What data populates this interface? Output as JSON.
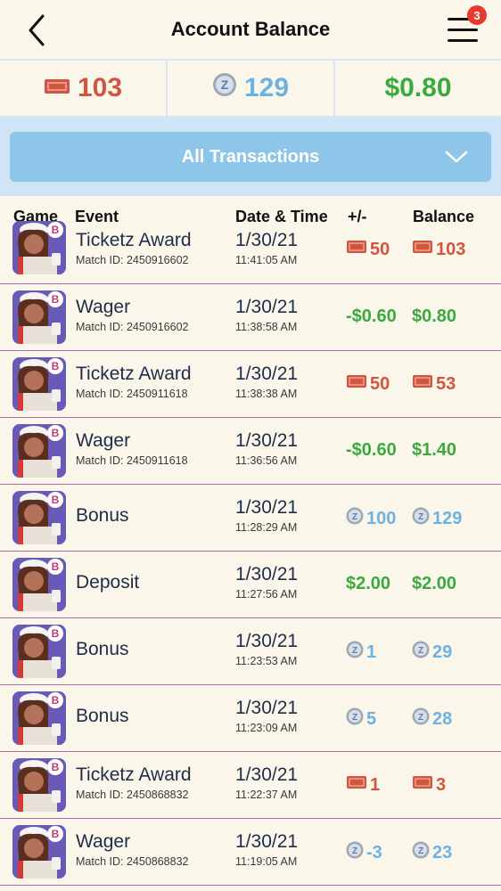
{
  "header": {
    "title": "Account Balance",
    "notification_count": "3"
  },
  "balances": {
    "tickets": "103",
    "coins": "129",
    "cash": "$0.80"
  },
  "filter": {
    "label": "All Transactions"
  },
  "columns": {
    "game": "Game",
    "event": "Event",
    "datetime": "Date & Time",
    "change": "+/-",
    "balance": "Balance"
  },
  "colors": {
    "ticket_red": "#d2553f",
    "coin_blue": "#6db2e0",
    "cash_green": "#3aaa3f",
    "filter_blue": "#8ec6ea",
    "row_divider": "#b06aa8"
  },
  "transactions": [
    {
      "event": "Ticketz Award",
      "match": "Match ID: 2450916602",
      "date": "1/30/21",
      "time": "11:41:05 AM",
      "change": "50",
      "change_type": "ticket",
      "balance": "103",
      "balance_type": "ticket"
    },
    {
      "event": "Wager",
      "match": "Match ID: 2450916602",
      "date": "1/30/21",
      "time": "11:38:58 AM",
      "change": "-$0.60",
      "change_type": "cash",
      "balance": "$0.80",
      "balance_type": "cash"
    },
    {
      "event": "Ticketz Award",
      "match": "Match ID: 2450911618",
      "date": "1/30/21",
      "time": "11:38:38 AM",
      "change": "50",
      "change_type": "ticket",
      "balance": "53",
      "balance_type": "ticket"
    },
    {
      "event": "Wager",
      "match": "Match ID: 2450911618",
      "date": "1/30/21",
      "time": "11:36:56 AM",
      "change": "-$0.60",
      "change_type": "cash",
      "balance": "$1.40",
      "balance_type": "cash"
    },
    {
      "event": "Bonus",
      "match": "",
      "date": "1/30/21",
      "time": "11:28:29 AM",
      "change": "100",
      "change_type": "coin",
      "balance": "129",
      "balance_type": "coin"
    },
    {
      "event": "Deposit",
      "match": "",
      "date": "1/30/21",
      "time": "11:27:56 AM",
      "change": "$2.00",
      "change_type": "cash",
      "balance": "$2.00",
      "balance_type": "cash"
    },
    {
      "event": "Bonus",
      "match": "",
      "date": "1/30/21",
      "time": "11:23:53 AM",
      "change": "1",
      "change_type": "coin",
      "balance": "29",
      "balance_type": "coin"
    },
    {
      "event": "Bonus",
      "match": "",
      "date": "1/30/21",
      "time": "11:23:09 AM",
      "change": "5",
      "change_type": "coin",
      "balance": "28",
      "balance_type": "coin"
    },
    {
      "event": "Ticketz Award",
      "match": "Match ID: 2450868832",
      "date": "1/30/21",
      "time": "11:22:37 AM",
      "change": "1",
      "change_type": "ticket",
      "balance": "3",
      "balance_type": "ticket"
    },
    {
      "event": "Wager",
      "match": "Match ID: 2450868832",
      "date": "1/30/21",
      "time": "11:19:05 AM",
      "change": "-3",
      "change_type": "coin",
      "balance": "23",
      "balance_type": "coin"
    }
  ]
}
